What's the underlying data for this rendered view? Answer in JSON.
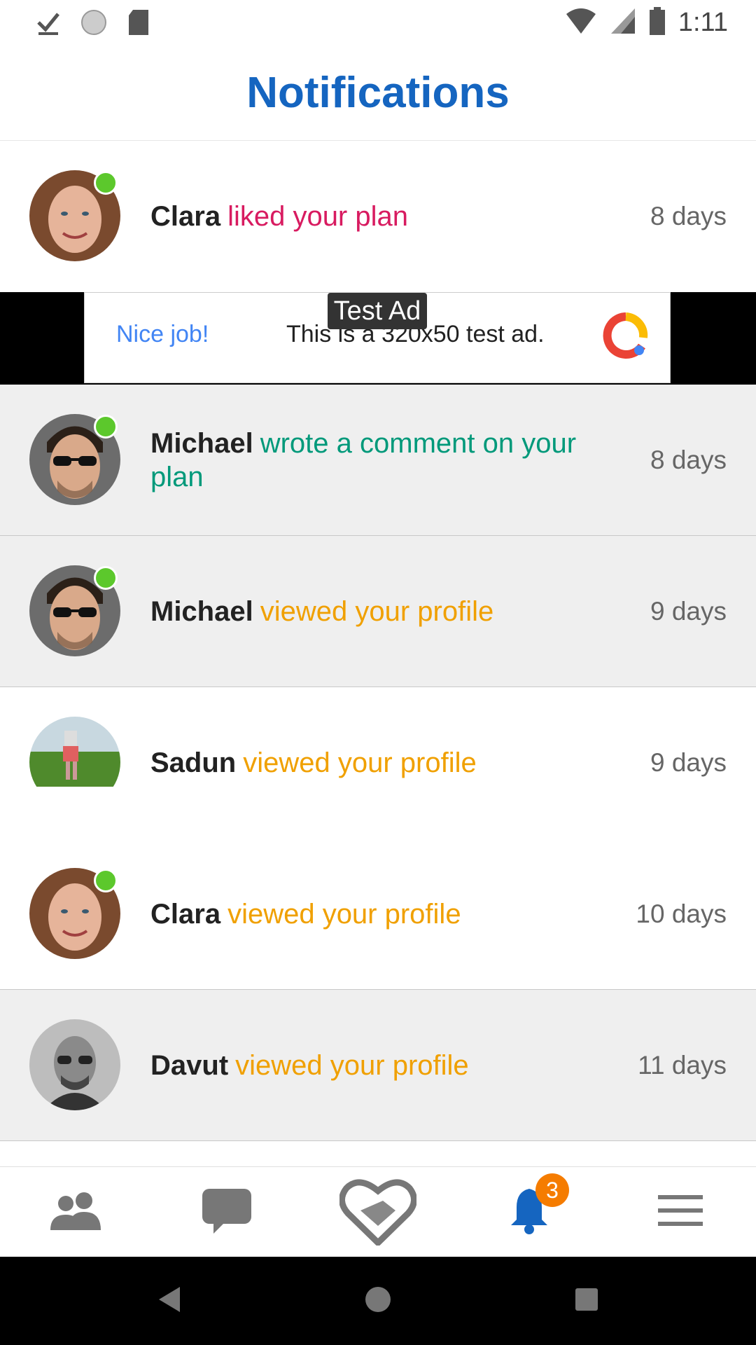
{
  "status_bar": {
    "time": "1:11",
    "icons": [
      "download-done-icon",
      "sync-icon",
      "sd-card-icon",
      "wifi-icon",
      "signal-icon",
      "battery-icon"
    ]
  },
  "header": {
    "title": "Notifications"
  },
  "colors": {
    "title_blue": "#1565c0",
    "liked": "#d81b60",
    "comment": "#00997a",
    "viewed": "#f0a000",
    "online": "#5cc82c",
    "badge": "#f57c00"
  },
  "notifications": [
    {
      "name": "Clara",
      "action": "liked your plan",
      "time": "8 days"
    },
    {
      "name": "Michael",
      "action": "wrote a comment on your plan",
      "time": "8 days"
    },
    {
      "name": "Michael",
      "action": "viewed your profile",
      "time": "9 days"
    },
    {
      "name": "Sadun",
      "action": "viewed your profile",
      "time": "9 days"
    },
    {
      "name": "Clara",
      "action": "viewed your profile",
      "time": "10 days"
    },
    {
      "name": "Davut",
      "action": "viewed your profile",
      "time": "11 days"
    }
  ],
  "ad": {
    "tag": "Test Ad",
    "headline": "Nice job!",
    "body": "This is a 320x50 test ad."
  },
  "bottom_nav": {
    "items": [
      "people-icon",
      "chat-icon",
      "handshake-heart-icon",
      "bell-icon",
      "menu-icon"
    ],
    "notification_badge": "3"
  },
  "system_nav": [
    "back-icon",
    "home-icon",
    "recents-icon"
  ]
}
